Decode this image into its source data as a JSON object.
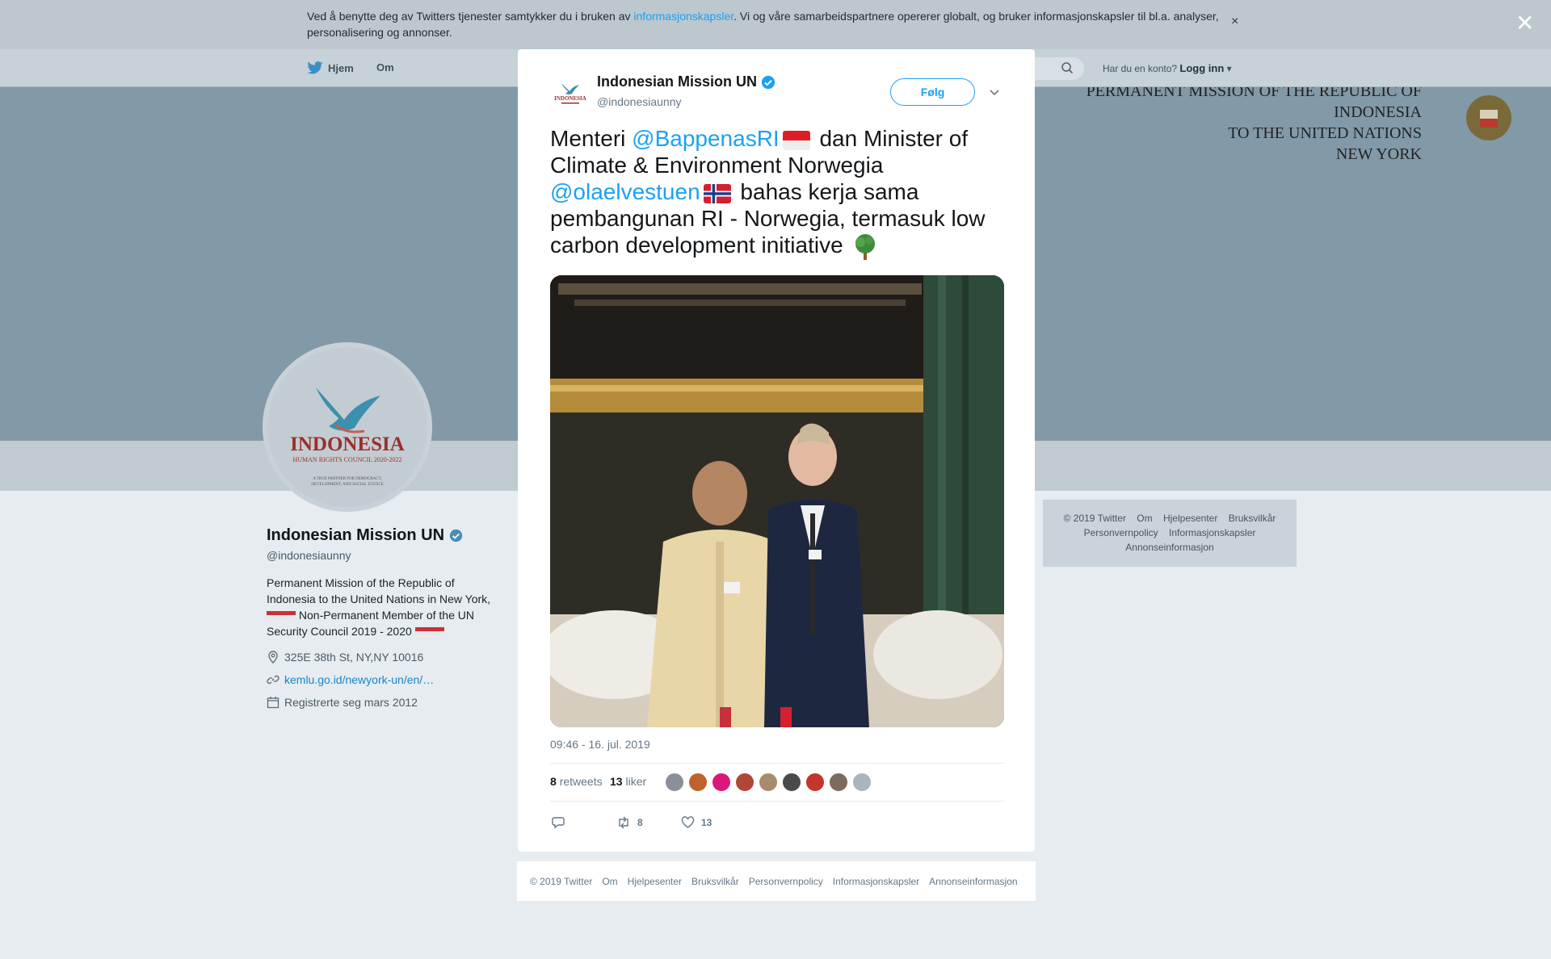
{
  "cookie_banner": {
    "text_before": "Ved å benytte deg av Twitters tjenester samtykker du i bruken av ",
    "link": "informasjonskapsler",
    "text_after": ". Vi og våre samarbeidspartnere opererer globalt, og bruker informasjonskapsler til bl.a. analyser, personalisering og annonser.",
    "close": "×"
  },
  "nav": {
    "home": "Hjem",
    "about": "Om",
    "account_prompt": "Har du en konto?",
    "login": "Logg inn"
  },
  "cover": {
    "line1": "PERMANENT MISSION OF THE REPUBLIC OF INDONESIA",
    "line2": "TO THE UNITED NATIONS",
    "line3": "NEW YORK"
  },
  "profile": {
    "name": "Indonesian Mission UN",
    "handle": "@indonesiaunny",
    "bio_1": "Permanent Mission of the Republic of Indonesia to the United Nations in New York,",
    "bio_2": " Non-Permanent Member of the UN Security Council 2019 - 2020 ",
    "location": "325E 38th St, NY,NY 10016",
    "website": "kemlu.go.id/newyork-un/en/…",
    "joined": "Registrerte seg mars 2012",
    "logo_word": "INDONESIA",
    "logo_sub": "HUMAN RIGHTS COUNCIL 2020-2022",
    "logo_tag1": "A TRUE PARTNER FOR DEMOCRACY,",
    "logo_tag2": "DEVELOPMENT, AND SOCIAL JUSTICE"
  },
  "side_footer": {
    "row1": [
      "© 2019 Twitter",
      "Om",
      "Hjelpesenter",
      "Bruksvilkår"
    ],
    "row2": [
      "Personvernpolicy",
      "Informasjonskapsler"
    ],
    "row3": [
      "Annonseinformasjon"
    ]
  },
  "tweet": {
    "author_name": "Indonesian Mission UN",
    "author_handle": "@indonesiaunny",
    "follow_label": "Følg",
    "text_1": "Menteri ",
    "mention_1": "@BappenasRI",
    "text_2": " dan Minister of Climate & Environment Norwegia",
    "mention_2": "@olaelvestuen",
    "text_3": " bahas kerja sama pembangunan RI - Norwegia, termasuk low carbon development initiative ",
    "timestamp": "09:46 - 16. jul. 2019",
    "retweets_count": "8",
    "retweets_label": "retweets",
    "likes_count": "13",
    "likes_label": "liker",
    "action_retweet_count": "8",
    "action_like_count": "13"
  },
  "modal_footer": [
    "© 2019 Twitter",
    "Om",
    "Hjelpesenter",
    "Bruksvilkår",
    "Personvernpolicy",
    "Informasjonskapsler",
    "Annonseinformasjon"
  ],
  "colors": {
    "accent": "#1da1f2",
    "verified": "#1da1f2",
    "cover": "#8299a8"
  },
  "liker_colors": [
    "#8a8f99",
    "#c0622b",
    "#d8197a",
    "#b04638",
    "#a88b6a",
    "#4a4a4a",
    "#c4352a",
    "#7d6a5e",
    "#aab4bf"
  ]
}
